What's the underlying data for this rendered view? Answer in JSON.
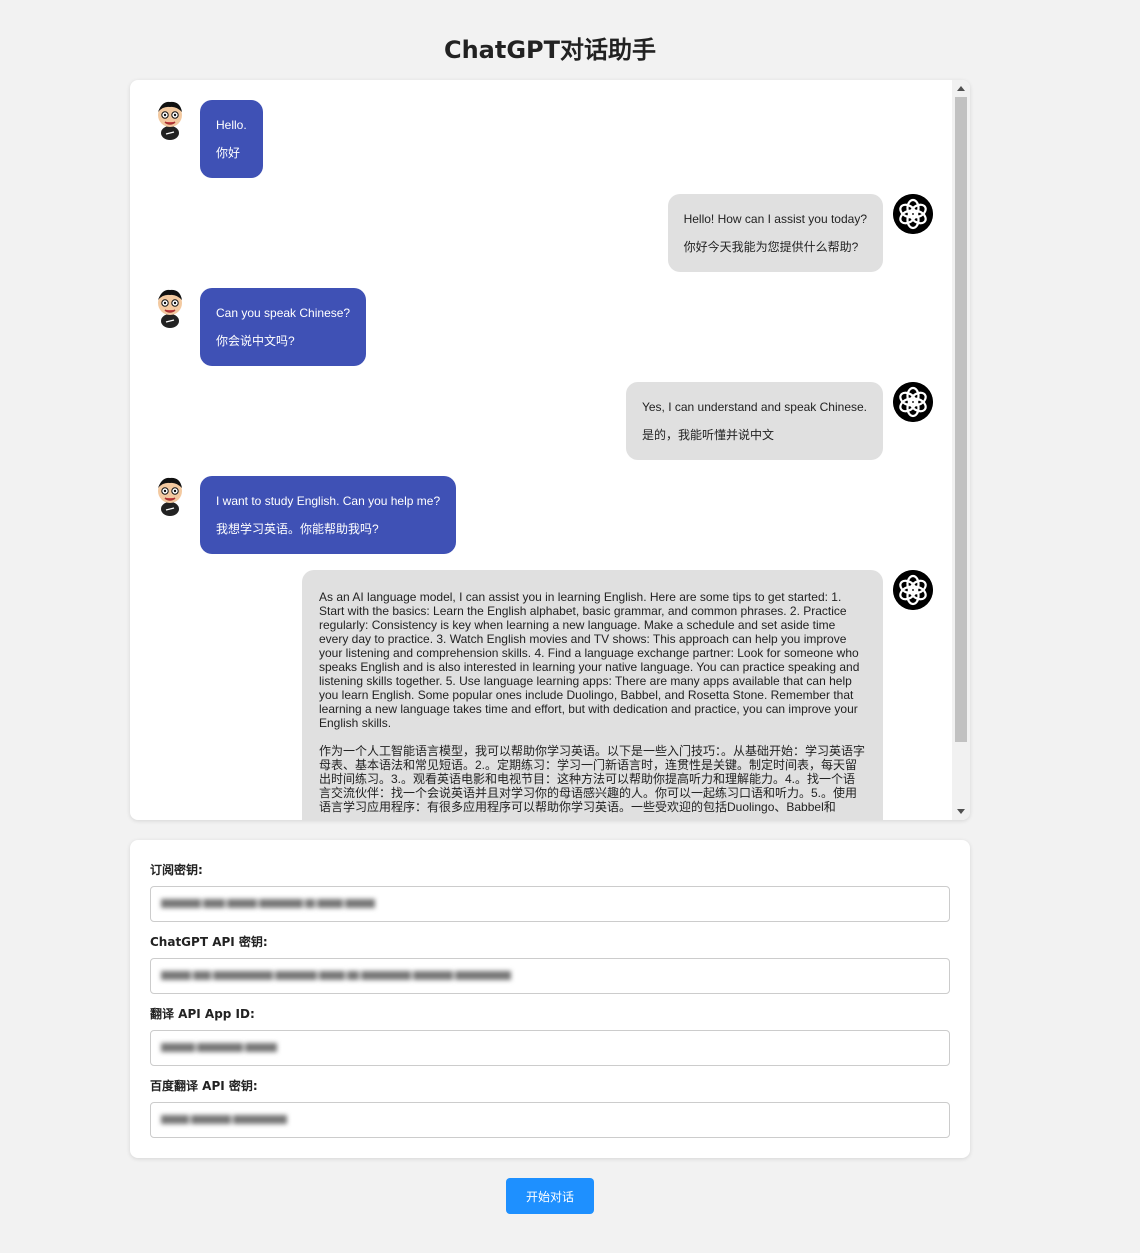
{
  "title": "ChatGPT对话助手",
  "messages": [
    {
      "role": "user",
      "en": "Hello.",
      "zh": "你好"
    },
    {
      "role": "assistant",
      "en": "Hello! How can I assist you today?",
      "zh": "你好今天我能为您提供什么帮助?"
    },
    {
      "role": "user",
      "en": "Can you speak Chinese?",
      "zh": "你会说中文吗?"
    },
    {
      "role": "assistant",
      "en": "Yes, I can understand and speak Chinese.",
      "zh": "是的，我能听懂并说中文"
    },
    {
      "role": "user",
      "en": "I want to study English. Can you help me?",
      "zh": "我想学习英语。你能帮助我吗?"
    },
    {
      "role": "assistant",
      "en": "As an AI language model, I can assist you in learning English. Here are some tips to get started: 1. Start with the basics: Learn the English alphabet, basic grammar, and common phrases. 2. Practice regularly: Consistency is key when learning a new language. Make a schedule and set aside time every day to practice. 3. Watch English movies and TV shows: This approach can help you improve your listening and comprehension skills. 4. Find a language exchange partner: Look for someone who speaks English and is also interested in learning your native language. You can practice speaking and listening skills together. 5. Use language learning apps: There are many apps available that can help you learn English. Some popular ones include Duolingo, Babbel, and Rosetta Stone. Remember that learning a new language takes time and effort, but with dedication and practice, you can improve your English skills.",
      "zh": "作为一个人工智能语言模型，我可以帮助你学习英语。以下是一些入门技巧：。从基础开始：学习英语字母表、基本语法和常见短语。2.。定期练习：学习一门新语言时，连贯性是关键。制定时间表，每天留出时间练习。3.。观看英语电影和电视节目：这种方法可以帮助你提高听力和理解能力。4.。找一个语言交流伙伴：找一个会说英语并且对学习你的母语感兴趣的人。你可以一起练习口语和听力。5.。使用语言学习应用程序：有很多应用程序可以帮助你学习英语。一些受欢迎的包括Duolingo、Babbel和"
    }
  ],
  "fields": {
    "subscription_label": "订阅密钥:",
    "chatgpt_key_label": "ChatGPT API 密钥:",
    "translate_appid_label": "翻译 API App ID:",
    "baidu_key_label": "百度翻译 API 密钥:"
  },
  "start_button_label": "开始对话",
  "icons": {
    "user_avatar": "cartoon-boy-avatar-icon",
    "bot_avatar": "openai-logo-icon"
  },
  "colors": {
    "user_bubble": "#3f51b5",
    "bot_bubble": "#e0e0e0",
    "button": "#1e90ff"
  }
}
